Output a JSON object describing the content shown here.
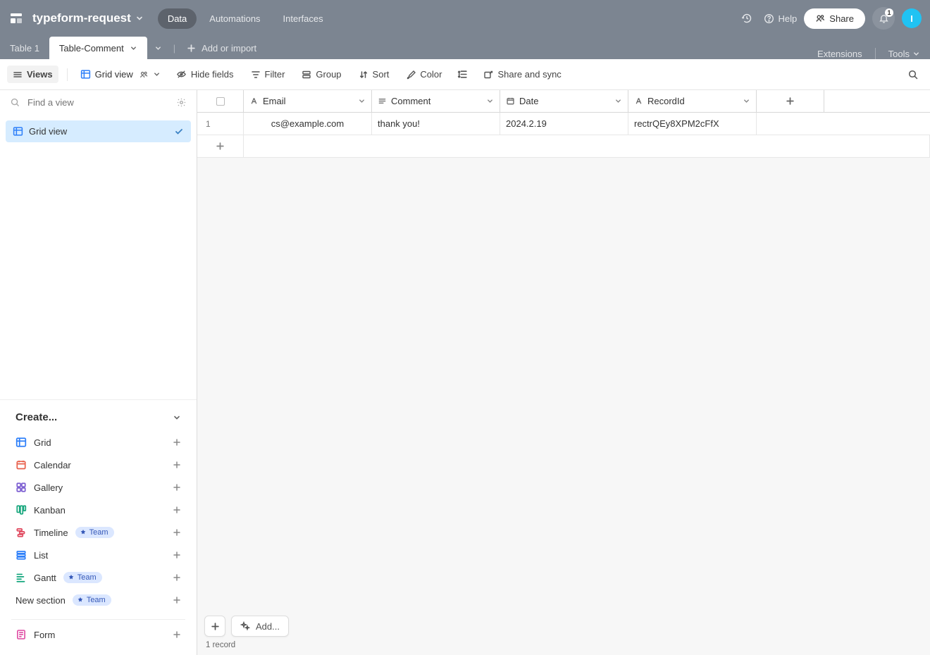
{
  "header": {
    "base_name": "typeform-request",
    "nav": {
      "data": "Data",
      "automations": "Automations",
      "interfaces": "Interfaces"
    },
    "help": "Help",
    "share": "Share",
    "notif_count": "1",
    "avatar_initial": "I"
  },
  "tabs": {
    "items": [
      {
        "label": "Table 1"
      },
      {
        "label": "Table-Comment"
      }
    ],
    "add_or_import": "Add or import",
    "extensions": "Extensions",
    "tools": "Tools"
  },
  "toolbar": {
    "views": "Views",
    "grid_view": "Grid view",
    "hide_fields": "Hide fields",
    "filter": "Filter",
    "group": "Group",
    "sort": "Sort",
    "color": "Color",
    "share_sync": "Share and sync"
  },
  "sidebar": {
    "find_placeholder": "Find a view",
    "views": [
      {
        "label": "Grid view"
      }
    ],
    "create_label": "Create...",
    "create_items": {
      "grid": "Grid",
      "calendar": "Calendar",
      "gallery": "Gallery",
      "kanban": "Kanban",
      "timeline": "Timeline",
      "list": "List",
      "gantt": "Gantt",
      "new_section": "New section",
      "form": "Form"
    },
    "team_badge": "Team"
  },
  "grid": {
    "columns": {
      "email": "Email",
      "comment": "Comment",
      "date": "Date",
      "recordid": "RecordId"
    },
    "rows": [
      {
        "num": "1",
        "email": "cs@example.com",
        "comment": "thank you!",
        "date": "2024.2.19",
        "recordid": "rectrQEy8XPM2cFfX"
      }
    ],
    "add_label": "Add...",
    "record_count": "1 record"
  },
  "colors": {
    "accent_blue": "#2d7ff9",
    "avatar_bg": "#20c3f3"
  }
}
